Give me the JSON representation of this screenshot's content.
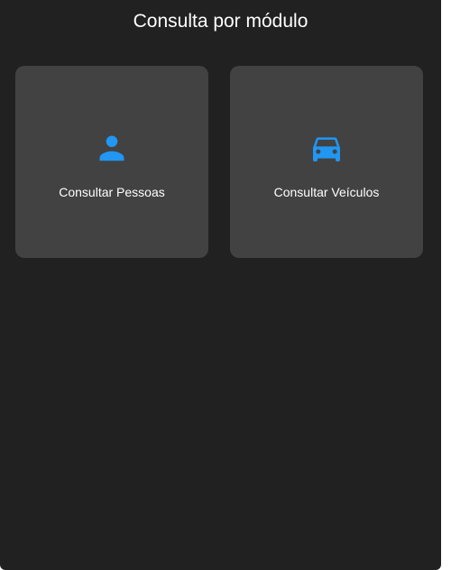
{
  "header": {
    "title": "Consulta por módulo"
  },
  "modules": [
    {
      "label": "Consultar Pessoas",
      "icon": "person-icon"
    },
    {
      "label": "Consultar Veículos",
      "icon": "car-icon"
    }
  ],
  "colors": {
    "background": "#212121",
    "card": "#424242",
    "accent": "#2196F3",
    "text": "#ffffff"
  }
}
